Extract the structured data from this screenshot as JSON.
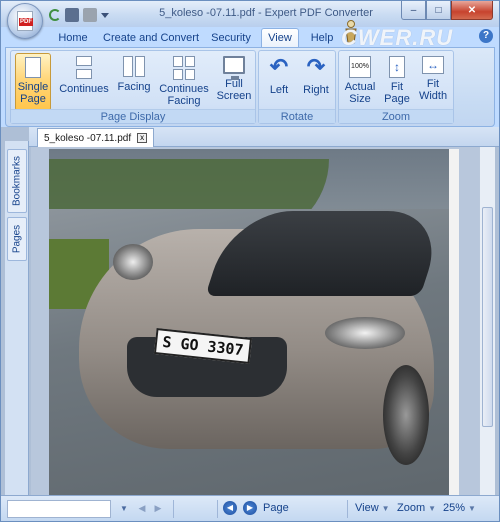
{
  "window": {
    "title": "5_koleso -07.11.pdf - Expert PDF Converter",
    "app_icon_label": "PDF",
    "watermark": "CWER.RU",
    "controls": {
      "minimize": "–",
      "maximize": "□",
      "close": "✕"
    }
  },
  "ribbon": {
    "tabs": [
      {
        "label": "Home",
        "active": false
      },
      {
        "label": "Create and Convert",
        "active": false
      },
      {
        "label": "Security",
        "active": false
      },
      {
        "label": "View",
        "active": true
      },
      {
        "label": "Help",
        "active": false
      }
    ],
    "help_icon": "?",
    "groups": {
      "page_display": {
        "label": "Page Display",
        "buttons": [
          {
            "label": "Single Page",
            "icon": "single-page-icon",
            "selected": true
          },
          {
            "label": "Continues",
            "icon": "continues-icon",
            "selected": false
          },
          {
            "label": "Facing",
            "icon": "facing-icon",
            "selected": false
          },
          {
            "label": "Continues Facing",
            "icon": "continues-facing-icon",
            "selected": false
          },
          {
            "label": "Full Screen",
            "icon": "full-screen-icon",
            "selected": false
          }
        ]
      },
      "rotate": {
        "label": "Rotate",
        "buttons": [
          {
            "label": "Left",
            "icon": "rotate-left-icon"
          },
          {
            "label": "Right",
            "icon": "rotate-right-icon"
          }
        ]
      },
      "zoom": {
        "label": "Zoom",
        "buttons": [
          {
            "label": "Actual Size",
            "icon": "actual-size-icon",
            "icon_text": "100%"
          },
          {
            "label": "Fit Page",
            "icon": "fit-page-icon"
          },
          {
            "label": "Fit Width",
            "icon": "fit-width-icon"
          }
        ]
      }
    }
  },
  "document": {
    "tab_label": "5_koleso -07.11.pdf",
    "tab_close": "x",
    "side_tabs": [
      "Bookmarks",
      "Pages"
    ],
    "plate_text": "S GO 3307"
  },
  "statusbar": {
    "page_label": "Page",
    "view_label": "View",
    "zoom_label": "Zoom",
    "zoom_value": "25%"
  }
}
